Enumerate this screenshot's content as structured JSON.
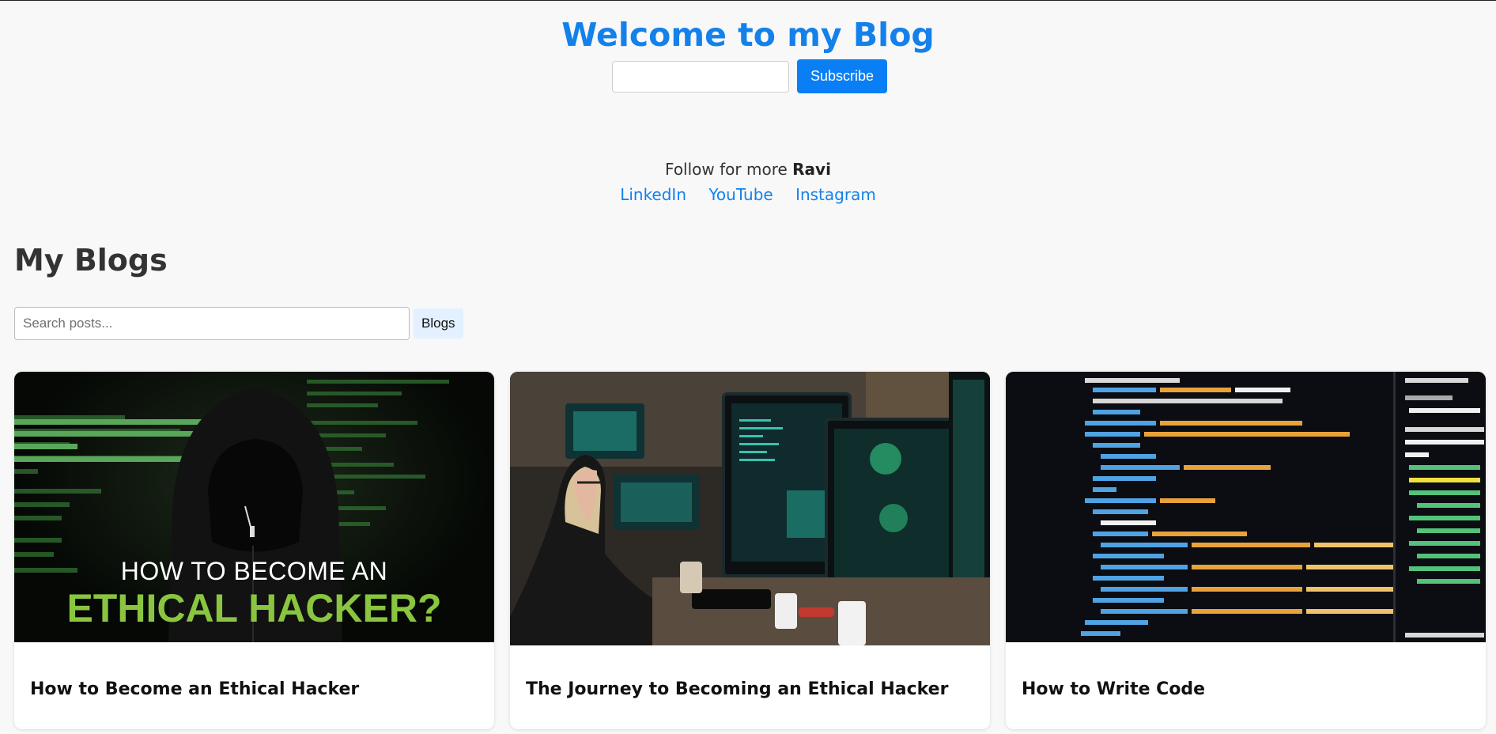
{
  "header": {
    "title": "Welcome to my Blog",
    "subscribe_label": "Subscribe",
    "email_placeholder": ""
  },
  "follow": {
    "text": "Follow for more ",
    "name": "Ravi",
    "links": [
      "LinkedIn",
      "YouTube",
      "Instagram"
    ]
  },
  "blogs": {
    "heading": "My Blogs",
    "search_placeholder": "Search posts...",
    "filter_label": "Blogs",
    "posts": [
      {
        "title": "How to Become an Ethical Hacker",
        "image_text_1": "HOW TO BECOME AN",
        "image_text_2": "ETHICAL HACKER?"
      },
      {
        "title": "The Journey to Becoming an Ethical Hacker"
      },
      {
        "title": "How to Write Code"
      }
    ]
  },
  "colors": {
    "accent": "#1481eb",
    "button": "#0a7ff5",
    "highlight_green": "#8ac53f",
    "background": "#f8f8f8"
  }
}
